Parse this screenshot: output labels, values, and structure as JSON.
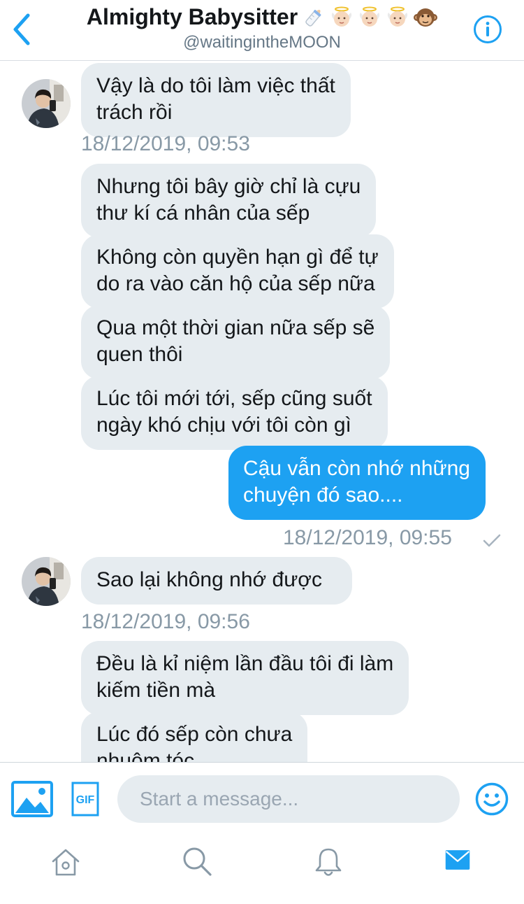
{
  "header": {
    "title": "Almighty Babysitter",
    "title_emojis": [
      "baby-bottle",
      "baby-angel",
      "baby-angel",
      "baby-angel",
      "monkey-face"
    ],
    "handle": "@waitingintheMOON"
  },
  "messages": [
    {
      "direction": "incoming",
      "text": "Vậy là do tôi làm việc thất\ntrách rồi",
      "avatar": true
    },
    {
      "timestamp": "18/12/2019, 09:53"
    },
    {
      "direction": "incoming",
      "text": "Nhưng tôi bây giờ chỉ là cựu\nthư kí cá nhân của sếp"
    },
    {
      "direction": "incoming",
      "text": "Không còn quyền hạn gì để tự\ndo ra vào căn hộ của sếp nữa"
    },
    {
      "direction": "incoming",
      "text": "Qua một thời gian nữa sếp sẽ\nquen thôi"
    },
    {
      "direction": "incoming",
      "text": "Lúc tôi mới tới, sếp cũng suốt\nngày khó chịu với tôi còn gì"
    },
    {
      "direction": "outgoing",
      "text": "Cậu vẫn còn nhớ những\nchuyện đó sao...."
    },
    {
      "timestamp": "18/12/2019, 09:55",
      "status": "sent-check"
    },
    {
      "direction": "incoming",
      "text": "Sao lại không nhớ được",
      "avatar": true
    },
    {
      "timestamp": "18/12/2019, 09:56"
    },
    {
      "direction": "incoming",
      "text": "Đều là kỉ niệm lần đầu tôi đi làm\nkiếm tiền mà"
    },
    {
      "direction": "incoming",
      "text": "Lúc đó sếp còn chưa\nnhuộm tóc"
    }
  ],
  "composer": {
    "placeholder": "Start a message...",
    "gif_label": "GIF"
  },
  "tabs": [
    {
      "name": "home",
      "active": false
    },
    {
      "name": "search",
      "active": false
    },
    {
      "name": "notifications",
      "active": false
    },
    {
      "name": "messages",
      "active": true
    }
  ],
  "colors": {
    "accent": "#1da1f2",
    "incoming_bubble": "#e6ecf0",
    "timestamp": "#8899a6",
    "inactive_icon": "#8899a6"
  }
}
